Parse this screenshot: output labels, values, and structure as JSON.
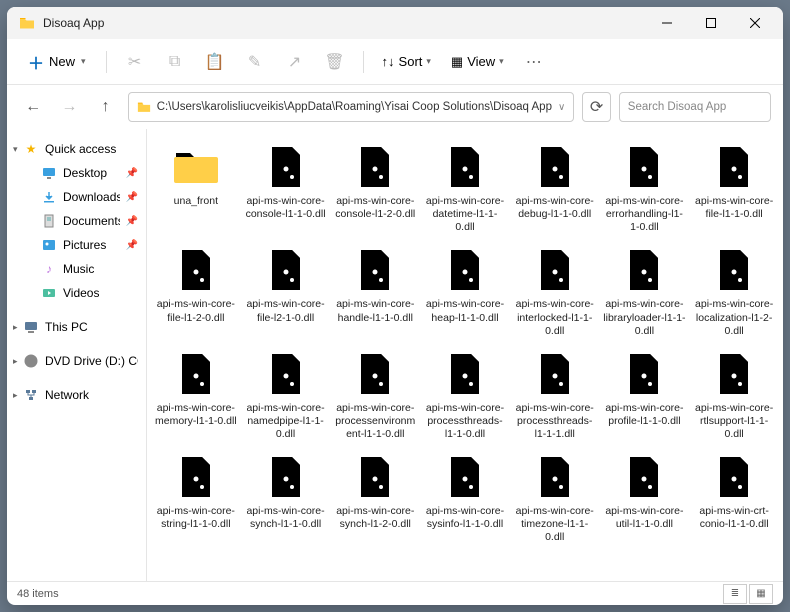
{
  "window": {
    "title": "Disoaq App"
  },
  "toolbar": {
    "new_label": "New",
    "sort_label": "Sort",
    "view_label": "View"
  },
  "address": {
    "path": "C:\\Users\\karolisliucveikis\\AppData\\Roaming\\Yisai Coop Solutions\\Disoaq App",
    "search_placeholder": "Search Disoaq App"
  },
  "nav": {
    "quick_access": "Quick access",
    "desktop": "Desktop",
    "downloads": "Downloads",
    "documents": "Documents",
    "pictures": "Pictures",
    "music": "Music",
    "videos": "Videos",
    "this_pc": "This PC",
    "dvd": "DVD Drive (D:) CCCC",
    "network": "Network"
  },
  "files": [
    {
      "name": "una_front",
      "type": "folder"
    },
    {
      "name": "api-ms-win-core-console-l1-1-0.dll",
      "type": "dll"
    },
    {
      "name": "api-ms-win-core-console-l1-2-0.dll",
      "type": "dll"
    },
    {
      "name": "api-ms-win-core-datetime-l1-1-0.dll",
      "type": "dll"
    },
    {
      "name": "api-ms-win-core-debug-l1-1-0.dll",
      "type": "dll"
    },
    {
      "name": "api-ms-win-core-errorhandling-l1-1-0.dll",
      "type": "dll"
    },
    {
      "name": "api-ms-win-core-file-l1-1-0.dll",
      "type": "dll"
    },
    {
      "name": "api-ms-win-core-file-l1-2-0.dll",
      "type": "dll"
    },
    {
      "name": "api-ms-win-core-file-l2-1-0.dll",
      "type": "dll"
    },
    {
      "name": "api-ms-win-core-handle-l1-1-0.dll",
      "type": "dll"
    },
    {
      "name": "api-ms-win-core-heap-l1-1-0.dll",
      "type": "dll"
    },
    {
      "name": "api-ms-win-core-interlocked-l1-1-0.dll",
      "type": "dll"
    },
    {
      "name": "api-ms-win-core-libraryloader-l1-1-0.dll",
      "type": "dll"
    },
    {
      "name": "api-ms-win-core-localization-l1-2-0.dll",
      "type": "dll"
    },
    {
      "name": "api-ms-win-core-memory-l1-1-0.dll",
      "type": "dll"
    },
    {
      "name": "api-ms-win-core-namedpipe-l1-1-0.dll",
      "type": "dll"
    },
    {
      "name": "api-ms-win-core-processenvironment-l1-1-0.dll",
      "type": "dll"
    },
    {
      "name": "api-ms-win-core-processthreads-l1-1-0.dll",
      "type": "dll"
    },
    {
      "name": "api-ms-win-core-processthreads-l1-1-1.dll",
      "type": "dll"
    },
    {
      "name": "api-ms-win-core-profile-l1-1-0.dll",
      "type": "dll"
    },
    {
      "name": "api-ms-win-core-rtlsupport-l1-1-0.dll",
      "type": "dll"
    },
    {
      "name": "api-ms-win-core-string-l1-1-0.dll",
      "type": "dll"
    },
    {
      "name": "api-ms-win-core-synch-l1-1-0.dll",
      "type": "dll"
    },
    {
      "name": "api-ms-win-core-synch-l1-2-0.dll",
      "type": "dll"
    },
    {
      "name": "api-ms-win-core-sysinfo-l1-1-0.dll",
      "type": "dll"
    },
    {
      "name": "api-ms-win-core-timezone-l1-1-0.dll",
      "type": "dll"
    },
    {
      "name": "api-ms-win-core-util-l1-1-0.dll",
      "type": "dll"
    },
    {
      "name": "api-ms-win-crt-conio-l1-1-0.dll",
      "type": "dll"
    }
  ],
  "status": {
    "count": "48 items"
  }
}
